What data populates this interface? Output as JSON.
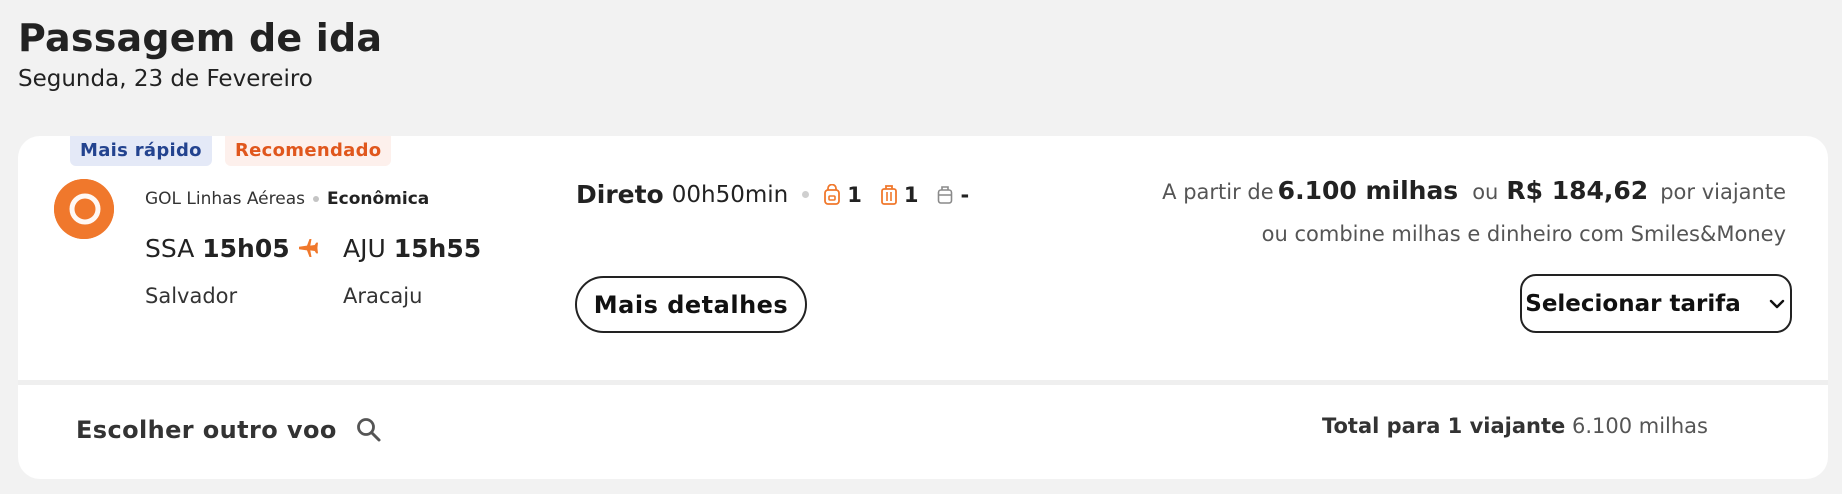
{
  "header": {
    "title": "Passagem de ida",
    "date": "Segunda, 23 de Fevereiro"
  },
  "badges": {
    "fastest": "Mais rápido",
    "recommended": "Recomendado"
  },
  "flight": {
    "airline": "GOL Linhas Aéreas",
    "fare_class": "Econômica",
    "origin_code": "SSA",
    "origin_time": "15h05",
    "origin_city": "Salvador",
    "dest_code": "AJU",
    "dest_time": "15h55",
    "dest_city": "Aracaju",
    "stops_label": "Direto",
    "duration": "00h50min",
    "personal_item_count": "1",
    "carry_on_count": "1",
    "checked_bag_count": "-"
  },
  "pricing": {
    "from_label": "A partir de",
    "miles": "6.100 milhas",
    "or_label": "ou",
    "cash": "R$ 184,62",
    "per_traveler": "por viajante",
    "combine_text": "ou combine milhas e dinheiro com Smiles&Money"
  },
  "actions": {
    "details_label": "Mais detalhes",
    "select_fare_label": "Selecionar tarifa",
    "choose_other_label": "Escolher outro voo"
  },
  "footer": {
    "total_label": "Total para 1 viajante",
    "total_value": "6.100 milhas"
  },
  "colors": {
    "accent": "#f0782c",
    "badge_fast_bg": "#e4e9f7",
    "badge_fast_text": "#23438f",
    "badge_rec_bg": "#fdf0ec",
    "badge_rec_text": "#e0571d"
  },
  "icons": {
    "airline_logo": "gol-logo-icon",
    "plane": "plane-icon",
    "personal_item": "backpack-icon",
    "carry_on": "carry-on-bag-icon",
    "checked_bag": "checked-bag-icon",
    "chevron": "chevron-down-icon",
    "search": "search-icon"
  }
}
